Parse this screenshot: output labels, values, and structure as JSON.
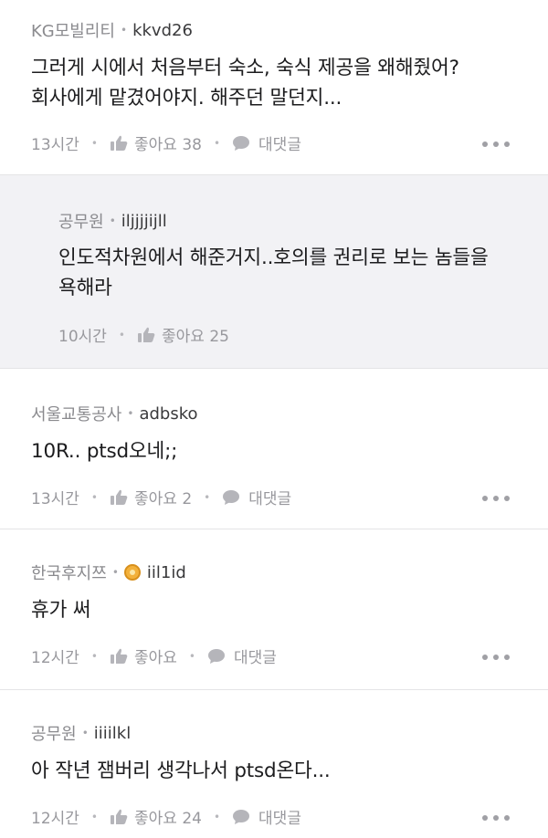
{
  "comments": [
    {
      "author": "KG모빌리티",
      "handle": "kkvd26",
      "text": [
        "그러게 시에서 처음부터 숙소, 숙식 제공을 왜해줬어?",
        "회사에게 맡겼어야지. 해주던 말던지..."
      ],
      "time": "13시간",
      "like_label": "좋아요 38",
      "reply_label": "대댓글",
      "is_reply": false,
      "has_badge": false
    },
    {
      "author": "공무원",
      "handle": "iljjjjijll",
      "text": [
        "인도적차원에서 해준거지..호의를 권리로 보는 놈들을",
        "욕해라"
      ],
      "time": "10시간",
      "like_label": "좋아요 25",
      "reply_label": "",
      "is_reply": true,
      "has_badge": false
    },
    {
      "author": "서울교통공사",
      "handle": "adbsko",
      "text": [
        "10R.. ptsd오네;;"
      ],
      "time": "13시간",
      "like_label": "좋아요 2",
      "reply_label": "대댓글",
      "is_reply": false,
      "has_badge": false
    },
    {
      "author": "한국후지쯔",
      "handle": "iil1id",
      "text": [
        "휴가 써"
      ],
      "time": "12시간",
      "like_label": "좋아요",
      "reply_label": "대댓글",
      "is_reply": false,
      "has_badge": true,
      "badge_color": "#f3b13b"
    },
    {
      "author": "공무원",
      "handle": "iiiilkl",
      "text": [
        "아 작년 잼버리 생각나서 ptsd온다..."
      ],
      "time": "12시간",
      "like_label": "좋아요 24",
      "reply_label": "대댓글",
      "is_reply": false,
      "has_badge": false
    }
  ],
  "icons": {
    "like": "thumbs-up-icon",
    "reply": "speech-bubble-icon",
    "more": "more-dots-icon",
    "badge": "coin-badge-icon"
  },
  "colors": {
    "reply_background": "#f2f2f5",
    "meta_text": "#8a8a8e",
    "body_text": "#1c1c1e",
    "badge": "#f3b13b"
  }
}
